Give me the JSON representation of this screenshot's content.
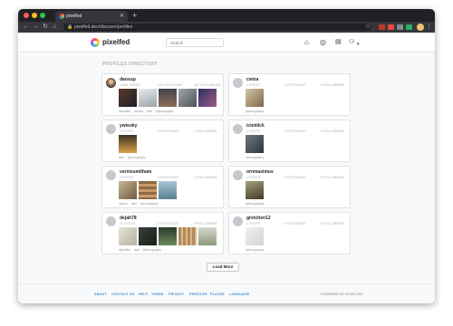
{
  "browser": {
    "tab_title": "pixelfed",
    "url": "pixelfed.dev/discover/profiles",
    "traffic_lights": [
      "#ff5f57",
      "#febc2e",
      "#28c840"
    ]
  },
  "header": {
    "logo_text": "pixelfed",
    "search_placeholder": "Search",
    "icons": [
      "home-icon",
      "compass-icon",
      "inbox-icon",
      "user-icon"
    ]
  },
  "directory": {
    "title": "PROFILES DIRECTORY",
    "profiles": [
      {
        "username": "dansup",
        "posts": "2,594 POSTS",
        "posts_per_day": "136 POSTS/DAY",
        "followers": "520 FOLLOWERS",
        "tags": [
          "#pixelfed",
          "#photo",
          "#art",
          "#photography"
        ]
      },
      {
        "username": "cwiza",
        "posts": "1 POSTS",
        "posts_per_day": "0 POSTS/DAY",
        "followers": "0 FOLLOWERS",
        "tags": [
          "#photography"
        ]
      },
      {
        "username": "ywisoky",
        "posts": "1 POSTS",
        "posts_per_day": "0 POSTS/DAY",
        "followers": "1 FOLLOWERS",
        "tags": [
          "#art",
          "#photography"
        ]
      },
      {
        "username": "icieblick",
        "posts": "1 POSTS",
        "posts_per_day": "0 POSTS/DAY",
        "followers": "0 FOLLOWERS",
        "tags": [
          "#photography"
        ]
      },
      {
        "username": "vernissmitham",
        "posts": "3 POSTS",
        "posts_per_day": "0 POSTS/DAY",
        "followers": "1 FOLLOWERS",
        "tags": [
          "#photo",
          "#art",
          "#photography"
        ]
      },
      {
        "username": "ornmaximus",
        "posts": "1 POSTS",
        "posts_per_day": "0 POSTS/DAY",
        "followers": "0 FOLLOWERS",
        "tags": [
          "#photography"
        ]
      },
      {
        "username": "dejah78",
        "posts": "10 POSTS",
        "posts_per_day": "0 POSTS/DAY",
        "followers": "0 FOLLOWERS",
        "tags": [
          "#pixelfed",
          "#art",
          "#photography"
        ]
      },
      {
        "username": "gretchen12",
        "posts": "1 POSTS",
        "posts_per_day": "0 POSTS/DAY",
        "followers": "0 FOLLOWERS",
        "tags": [
          "#photography"
        ]
      }
    ],
    "load_more": "Load More"
  },
  "footer": {
    "links": [
      "ABOUT",
      "CONTACT US",
      "HELP",
      "TERMS",
      "PRIVACY",
      "PROFILES",
      "PLACES",
      "LANGUAGE"
    ],
    "powered_by": "POWERED BY PIXELFED"
  }
}
